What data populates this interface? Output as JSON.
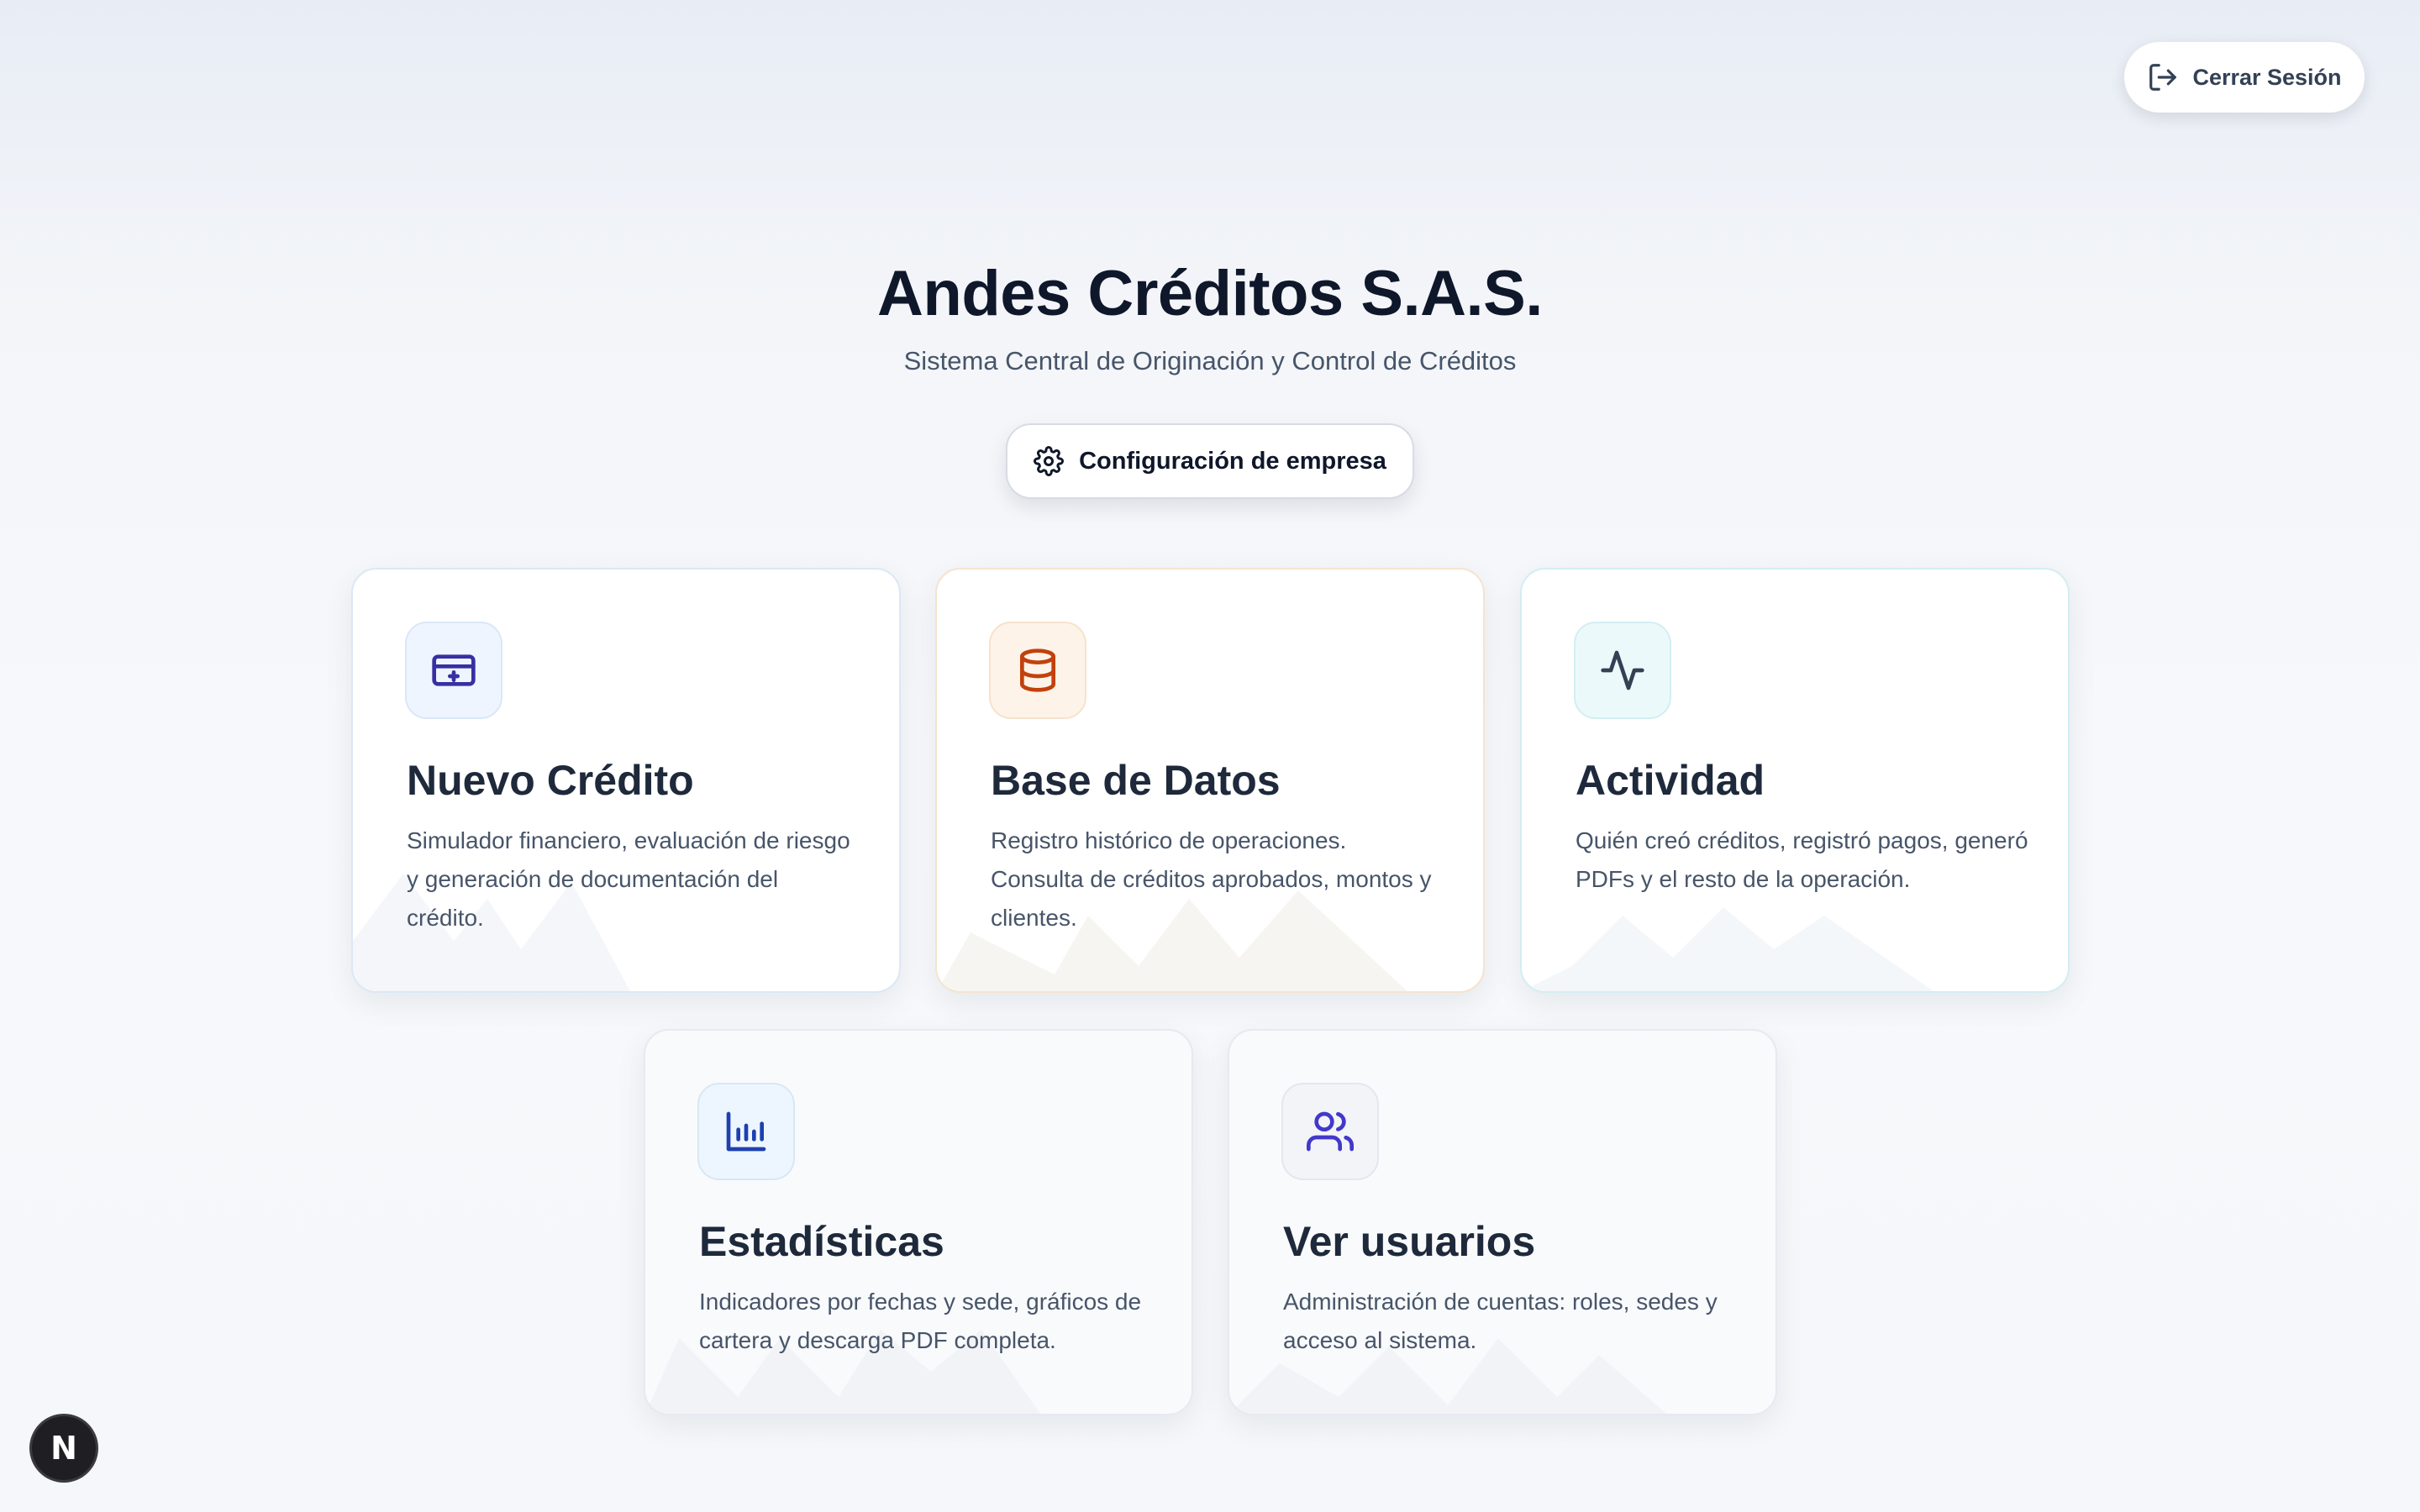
{
  "header": {
    "logout_label": "Cerrar Sesión",
    "logout_icon": "log-out-icon"
  },
  "hero": {
    "title": "Andes Créditos S.A.S.",
    "subtitle": "Sistema Central de Originación y Control de Créditos",
    "config_label": "Configuración de empresa",
    "config_icon": "gear-icon"
  },
  "cards": [
    {
      "title": "Nuevo Crédito",
      "description": "Simulador financiero, evaluación de riesgo y generación de documentación del crédito.",
      "icon": "credit-card-icon",
      "accent": "#3730a3"
    },
    {
      "title": "Base de Datos",
      "description": "Registro histórico de operaciones. Consulta de créditos aprobados, montos y clientes.",
      "icon": "database-icon",
      "accent": "#c2410c"
    },
    {
      "title": "Actividad",
      "description": "Quién creó créditos, registró pagos, generó PDFs y el resto de la operación.",
      "icon": "activity-icon",
      "accent": "#334155"
    },
    {
      "title": "Estadísticas",
      "description": "Indicadores por fechas y sede, gráficos de cartera y descarga PDF completa.",
      "icon": "bar-chart-icon",
      "accent": "#1e40af"
    },
    {
      "title": "Ver usuarios",
      "description": "Administración de cuentas: roles, sedes y acceso al sistema.",
      "icon": "users-icon",
      "accent": "#4338ca"
    }
  ],
  "dev_badge": {
    "letter": "N",
    "icon": "nextjs-icon"
  }
}
